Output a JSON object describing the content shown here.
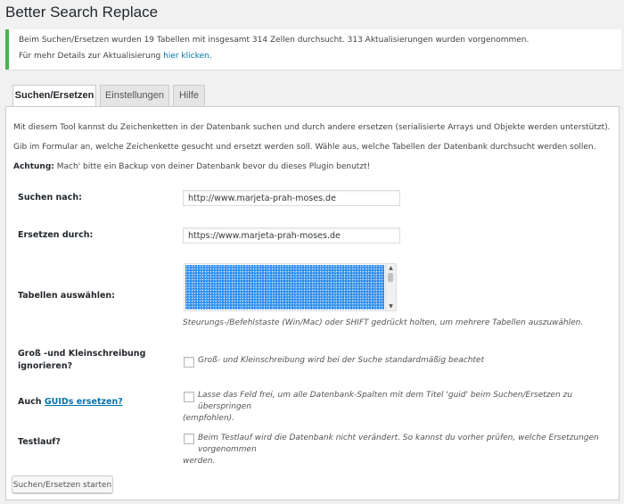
{
  "page": {
    "title": "Better Search Replace"
  },
  "notice": {
    "line1": "Beim Suchen/Ersetzen wurden 19 Tabellen mit insgesamt 314 Zellen durchsucht. 313 Aktualisierungen wurden vorgenommen.",
    "line2_prefix": "Für mehr Details zur Aktualisierung ",
    "line2_link": "hier klicken",
    "line2_suffix": "."
  },
  "tabs": [
    {
      "label": "Suchen/Ersetzen",
      "active": true
    },
    {
      "label": "Einstellungen",
      "active": false
    },
    {
      "label": "Hilfe",
      "active": false
    }
  ],
  "intro": {
    "p1": "Mit diesem Tool kannst du Zeichenketten in der Datenbank suchen und durch andere ersetzen (serialisierte Arrays und Objekte werden unterstützt).",
    "p2": "Gib im Formular an, welche Zeichenkette gesucht und ersetzt werden soll. Wähle aus, welche Tabellen der Datenbank durchsucht werden sollen.",
    "warning_label": "Achtung:",
    "warning_text": " Mach' bitte ein Backup von deiner Datenbank bevor du dieses Plugin benutzt!"
  },
  "form": {
    "search": {
      "label": "Suchen nach:",
      "value": "http://www.marjeta-prah-moses.de"
    },
    "replace": {
      "label": "Ersetzen durch:",
      "value": "https://www.marjeta-prah-moses.de"
    },
    "tables": {
      "label": "Tabellen auswählen:",
      "help": "Steurungs-/Befehlstaste (Win/Mac) oder SHIFT gedrückt holten, um mehrere Tabellen auszuwählen."
    },
    "case": {
      "label_line1": "Groß -und Kleinschreibung",
      "label_line2": "ignorieren?",
      "help": "Groß- und Kleinschreibung wird bei der Suche standardmäßig beachtet",
      "checked": false
    },
    "guids": {
      "label_prefix": "Auch ",
      "label_link": "GUIDs ersetzen?",
      "help_line1": "Lasse das Feld frei, um alle Datenbank-Spalten mit dem Titel 'guid' beim Suchen/Ersetzen zu überspringen",
      "help_line2": "(empfohlen).",
      "checked": false
    },
    "dryrun": {
      "label": "Testlauf?",
      "help_line1": "Beim Testlauf wird die Datenbank nicht verändert. So kannst du vorher prüfen, welche Ersetzungen vorgenommen",
      "help_line2": "werden.",
      "checked": false
    },
    "submit_label": "Suchen/Ersetzen starten"
  },
  "colors": {
    "accent": "#0073aa",
    "notice_border": "#46b450",
    "selection": "#2d8ef0"
  }
}
